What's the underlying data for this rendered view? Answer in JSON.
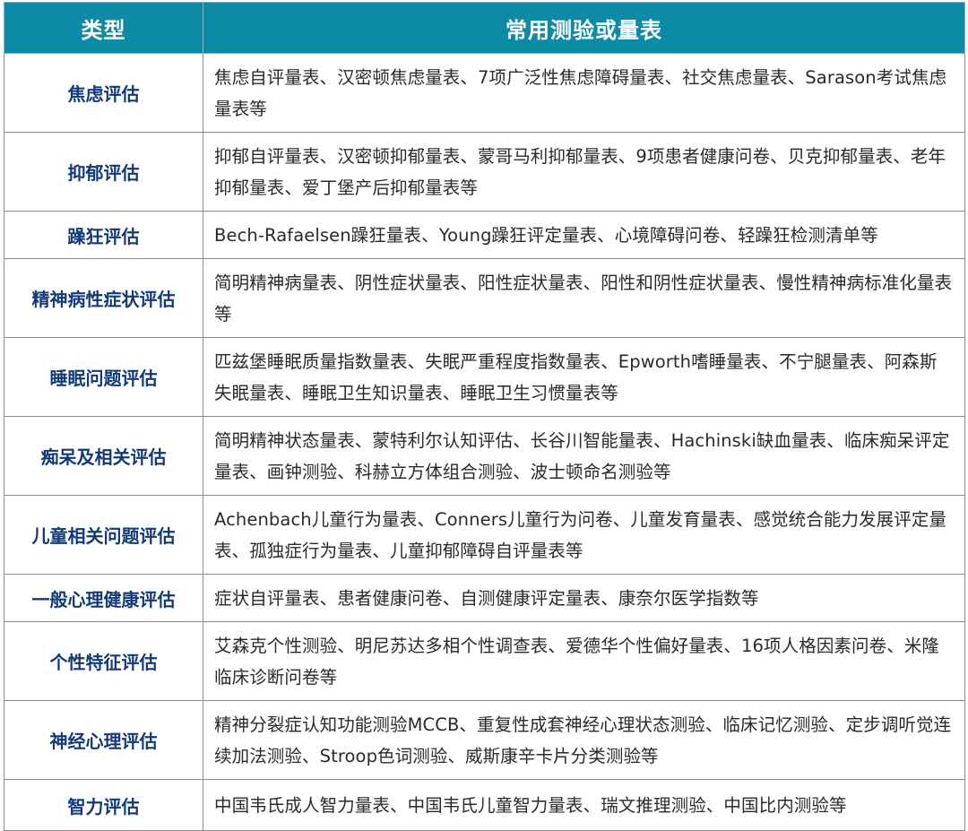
{
  "header": {
    "col_type": "类型",
    "col_tests": "常用测验或量表"
  },
  "rows": [
    {
      "type": "焦虑评估",
      "tests": "焦虑自评量表、汉密顿焦虑量表、7项广泛性焦虑障碍量表、社交焦虑量表、Sarason考试焦虑量表等"
    },
    {
      "type": "抑郁评估",
      "tests": "抑郁自评量表、汉密顿抑郁量表、蒙哥马利抑郁量表、9项患者健康问卷、贝克抑郁量表、老年抑郁量表、爱丁堡产后抑郁量表等"
    },
    {
      "type": "躁狂评估",
      "tests": "Bech-Rafaelsen躁狂量表、Young躁狂评定量表、心境障碍问卷、轻躁狂检测清单等"
    },
    {
      "type": "精神病性症状评估",
      "tests": "简明精神病量表、阴性症状量表、阳性症状量表、阳性和阴性症状量表、慢性精神病标准化量表等"
    },
    {
      "type": "睡眠问题评估",
      "tests": "匹兹堡睡眠质量指数量表、失眠严重程度指数量表、Epworth嗜睡量表、不宁腿量表、阿森斯失眠量表、睡眠卫生知识量表、睡眠卫生习惯量表等"
    },
    {
      "type": "痴呆及相关评估",
      "tests": "简明精神状态量表、蒙特利尔认知评估、长谷川智能量表、Hachinski缺血量表、临床痴呆评定量表、画钟测验、科赫立方体组合测验、波士顿命名测验等"
    },
    {
      "type": "儿童相关问题评估",
      "tests": "Achenbach儿童行为量表、Conners儿童行为问卷、儿童发育量表、感觉统合能力发展评定量表、孤独症行为量表、儿童抑郁障碍自评量表等"
    },
    {
      "type": "一般心理健康评估",
      "tests": "症状自评量表、患者健康问卷、自测健康评定量表、康奈尔医学指数等"
    },
    {
      "type": "个性特征评估",
      "tests": "艾森克个性测验、明尼苏达多相个性调查表、爱德华个性偏好量表、16项人格因素问卷、米隆临床诊断问卷等"
    },
    {
      "type": "神经心理评估",
      "tests": "精神分裂症认知功能测验MCCB、重复性成套神经心理状态测验、临床记忆测验、定步调听觉连续加法测验、Stroop色词测验、威斯康辛卡片分类测验等"
    },
    {
      "type": "智力评估",
      "tests": "中国韦氏成人智力量表、中国韦氏儿童智力量表、瑞文推理测验、中国比内测验等"
    }
  ]
}
